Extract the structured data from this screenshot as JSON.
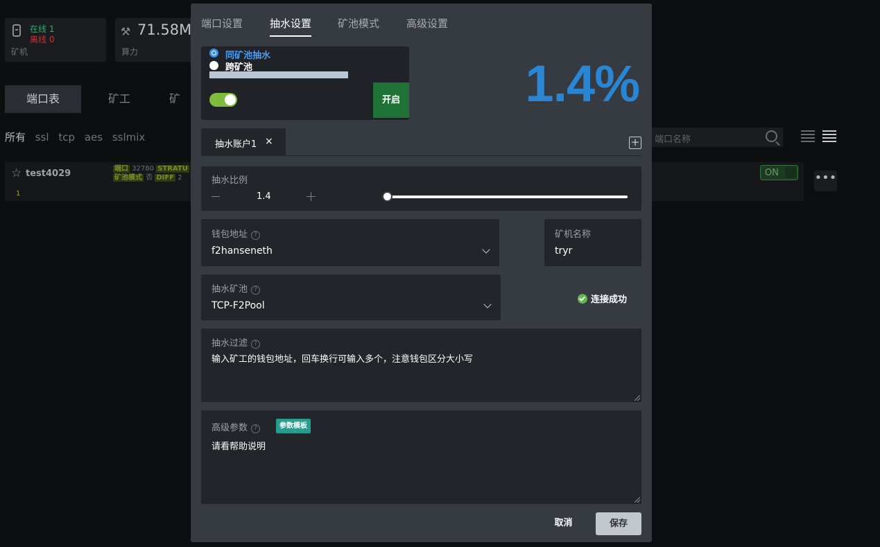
{
  "background": {
    "stats": {
      "online": "在线 1",
      "offline": "离线 0",
      "miners_label": "矿机",
      "hashrate": "71.58M",
      "hashrate_label": "算力"
    },
    "tabs": [
      "端口表",
      "矿工",
      "矿"
    ],
    "filters": [
      "所有",
      "ssl",
      "tcp",
      "aes",
      "sslmix"
    ],
    "search_placeholder": "端口名称",
    "row": {
      "name": "test4029",
      "badge": "1",
      "port_tag": "端口",
      "port_value": "32780",
      "stratum_tag": "STRATU",
      "pool_mode_tag": "矿池模式",
      "pool_mode_value": "否",
      "diff_tag": "DIFF",
      "diff_value": "2",
      "toggle": "ON",
      "more": "•••"
    }
  },
  "modal": {
    "tabs": [
      "端口设置",
      "抽水设置",
      "矿池模式",
      "高级设置"
    ],
    "active_tab": "抽水设置",
    "mode": {
      "option_same": "同矿池抽水",
      "option_cross": "跨矿池",
      "enabled": true,
      "open_button": "开启"
    },
    "percentage_display": "1.4%",
    "account_tab": "抽水账户1",
    "account_close": "×",
    "add_tab": "+",
    "ratio": {
      "label": "抽水比例",
      "value": "1.4",
      "slider_fraction": 0.014
    },
    "wallet": {
      "label": "钱包地址",
      "value": "f2hanseneth",
      "help": "?"
    },
    "miner_name": {
      "label": "矿机名称",
      "value": "tryr"
    },
    "pool": {
      "label": "抽水矿池",
      "value": "TCP-F2Pool",
      "help": "?"
    },
    "connection_status": "连接成功",
    "filter": {
      "label": "抽水过滤",
      "help": "?",
      "placeholder": "输入矿工的钱包地址，回车换行可输入多个，注意钱包区分大小写"
    },
    "advanced": {
      "label": "高级参数",
      "help": "?",
      "template_button": "参数模板",
      "placeholder": "请看帮助说明"
    },
    "cancel": "取消",
    "save": "保存"
  },
  "colors": {
    "accent_blue": "#2a86d2",
    "toggle_green": "#7fbb3f",
    "open_green": "#1f7336",
    "status_ok": "#5fb84b",
    "template_teal": "#2a9c8e"
  }
}
